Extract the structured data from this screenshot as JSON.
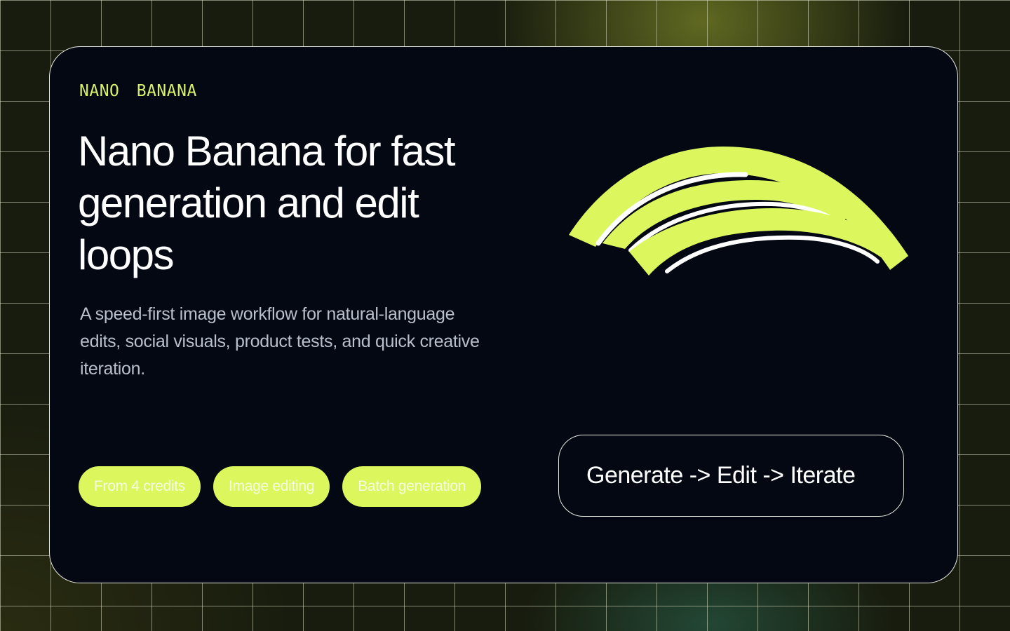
{
  "brand": {
    "eyebrow": "NANO BANANA"
  },
  "hero": {
    "headline": "Nano Banana for fast generation and edit loops",
    "description": "A speed-first image workflow for natural-language edits, social visuals, product tests, and quick creative iteration."
  },
  "chips": [
    {
      "label": "From 4 credits"
    },
    {
      "label": "Image editing"
    },
    {
      "label": "Batch generation"
    }
  ],
  "flow": {
    "label": "Generate -> Edit -> Iterate"
  },
  "colors": {
    "accent": "#dcf75e",
    "card_background": "#030812",
    "eyebrow": "#d9f06a",
    "headline": "#ffffff",
    "body_text": "#b9bfcc"
  },
  "icons": {
    "hero_art": "banana-arcs-illustration"
  }
}
